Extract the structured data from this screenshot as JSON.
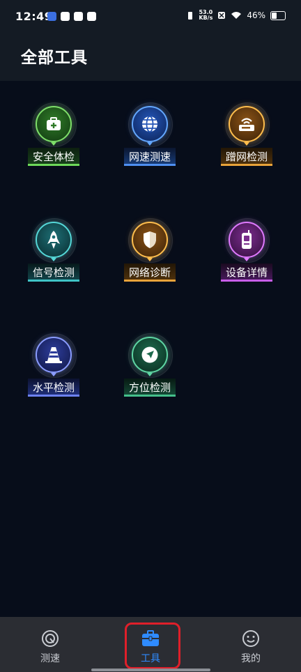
{
  "status_bar": {
    "time": "12:49",
    "net_speed_value": "53.0",
    "net_speed_unit": "KB/s",
    "battery": "46%"
  },
  "header": {
    "title": "全部工具"
  },
  "tools": [
    {
      "label": "安全体检",
      "icon": "medical-kit-icon",
      "color": "#6ed95a"
    },
    {
      "label": "网速测速",
      "icon": "globe-icon",
      "color": "#4f8ff0"
    },
    {
      "label": "蹭网检测",
      "icon": "router-icon",
      "color": "#e8a33a"
    },
    {
      "label": "信号检测",
      "icon": "rocket-icon",
      "color": "#3fc3c6"
    },
    {
      "label": "网络诊断",
      "icon": "shield-icon",
      "color": "#e8a33a"
    },
    {
      "label": "设备详情",
      "icon": "phone-device-icon",
      "color": "#c85ee8"
    },
    {
      "label": "水平检测",
      "icon": "traffic-cone-icon",
      "color": "#6d82f0"
    },
    {
      "label": "方位检测",
      "icon": "navigation-arrow-icon",
      "color": "#45bf8b"
    }
  ],
  "bottom_nav": {
    "items": [
      {
        "label": "测速",
        "icon": "speed-gauge-icon",
        "active": false
      },
      {
        "label": "工具",
        "icon": "toolbox-icon",
        "active": true
      },
      {
        "label": "我的",
        "icon": "smiley-icon",
        "active": false
      }
    ],
    "active_color": "#2f8bff"
  }
}
